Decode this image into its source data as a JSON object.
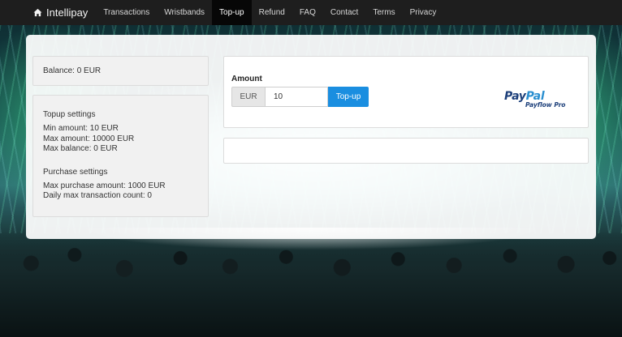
{
  "nav": {
    "brand": "Intellipay",
    "items": [
      {
        "label": "Transactions",
        "active": false
      },
      {
        "label": "Wristbands",
        "active": false
      },
      {
        "label": "Top-up",
        "active": true
      },
      {
        "label": "Refund",
        "active": false
      },
      {
        "label": "FAQ",
        "active": false
      },
      {
        "label": "Contact",
        "active": false
      },
      {
        "label": "Terms",
        "active": false
      },
      {
        "label": "Privacy",
        "active": false
      }
    ]
  },
  "balance": {
    "text": "Balance: 0 EUR"
  },
  "topup_settings": {
    "title": "Topup settings",
    "min_amount": "Min amount: 10 EUR",
    "max_amount": "Max amount: 10000 EUR",
    "max_balance": "Max balance: 0 EUR"
  },
  "purchase_settings": {
    "title": "Purchase settings",
    "max_purchase": "Max purchase amount: 1000 EUR",
    "daily_max": "Daily max transaction count: 0"
  },
  "topup_form": {
    "amount_label": "Amount",
    "currency": "EUR",
    "amount_value": "10",
    "submit_label": "Top-up"
  },
  "paypal": {
    "pay": "Pay",
    "pal": "Pal",
    "sub": "Payflow Pro"
  },
  "colors": {
    "navbar": "#1e1e1e",
    "nav_active": "#070707",
    "primary_button": "#1a8ee0",
    "paypal_dark": "#1c3f7a",
    "paypal_light": "#2a8fd0"
  }
}
